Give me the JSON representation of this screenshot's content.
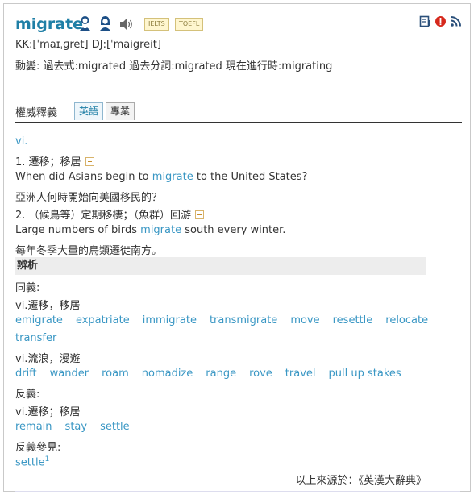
{
  "entry": {
    "word": "migrate",
    "tags": [
      "IELTS",
      "TOEFL"
    ],
    "pronunciation": "KK:[ˈmaɪˌɡret] DJ:[ˈmaigreit]",
    "forms": "動變: 過去式:migrated  過去分詞:migrated  現在進行時:migrating"
  },
  "icons": {
    "speaker_female": "female-speaker-icon",
    "speaker_male": "male-speaker-icon",
    "sound": "speaker-icon",
    "notebook": "wordbook-icon",
    "report": "report-icon",
    "rss": "rss-icon"
  },
  "tabs": {
    "section_title": "權威釋義",
    "items": [
      {
        "label": "英語",
        "active": true
      },
      {
        "label": "專業",
        "active": false
      }
    ]
  },
  "definitions": {
    "pos": "vi.",
    "senses": [
      {
        "definition": "1. 遷移；移居",
        "example_before": "When did Asians begin to ",
        "example_word": "migrate",
        "example_after": " to the United States?",
        "translation": "亞洲人何時開始向美國移民的？"
      },
      {
        "definition": "2. （候鳥等）定期移棲；（魚群）回游",
        "example_before": "Large numbers of birds ",
        "example_word": "migrate",
        "example_after": " south every winter.",
        "translation": "每年冬季大量的鳥類遷徙南方。"
      }
    ]
  },
  "analysis": {
    "title": "辨析",
    "synonyms_label": "同義:",
    "syn_group1_label": "vi.遷移，移居",
    "syn_group1": [
      "emigrate",
      "expatriate",
      "immigrate",
      "transmigrate",
      "move",
      "resettle",
      "relocate",
      "transfer"
    ],
    "syn_group2_label": "vi.流浪，漫遊",
    "syn_group2": [
      "drift",
      "wander",
      "roam",
      "nomadize",
      "range",
      "rove",
      "travel",
      "pull up stakes"
    ],
    "antonyms_label": "反義:",
    "ant_group_label": "vi.遷移；移居",
    "ant_group": [
      "remain",
      "stay",
      "settle"
    ],
    "see_also_label": "反義參見:",
    "see_also_word": "settle",
    "see_also_sup": "1"
  },
  "source": "以上來源於：《英漢大辭典》"
}
